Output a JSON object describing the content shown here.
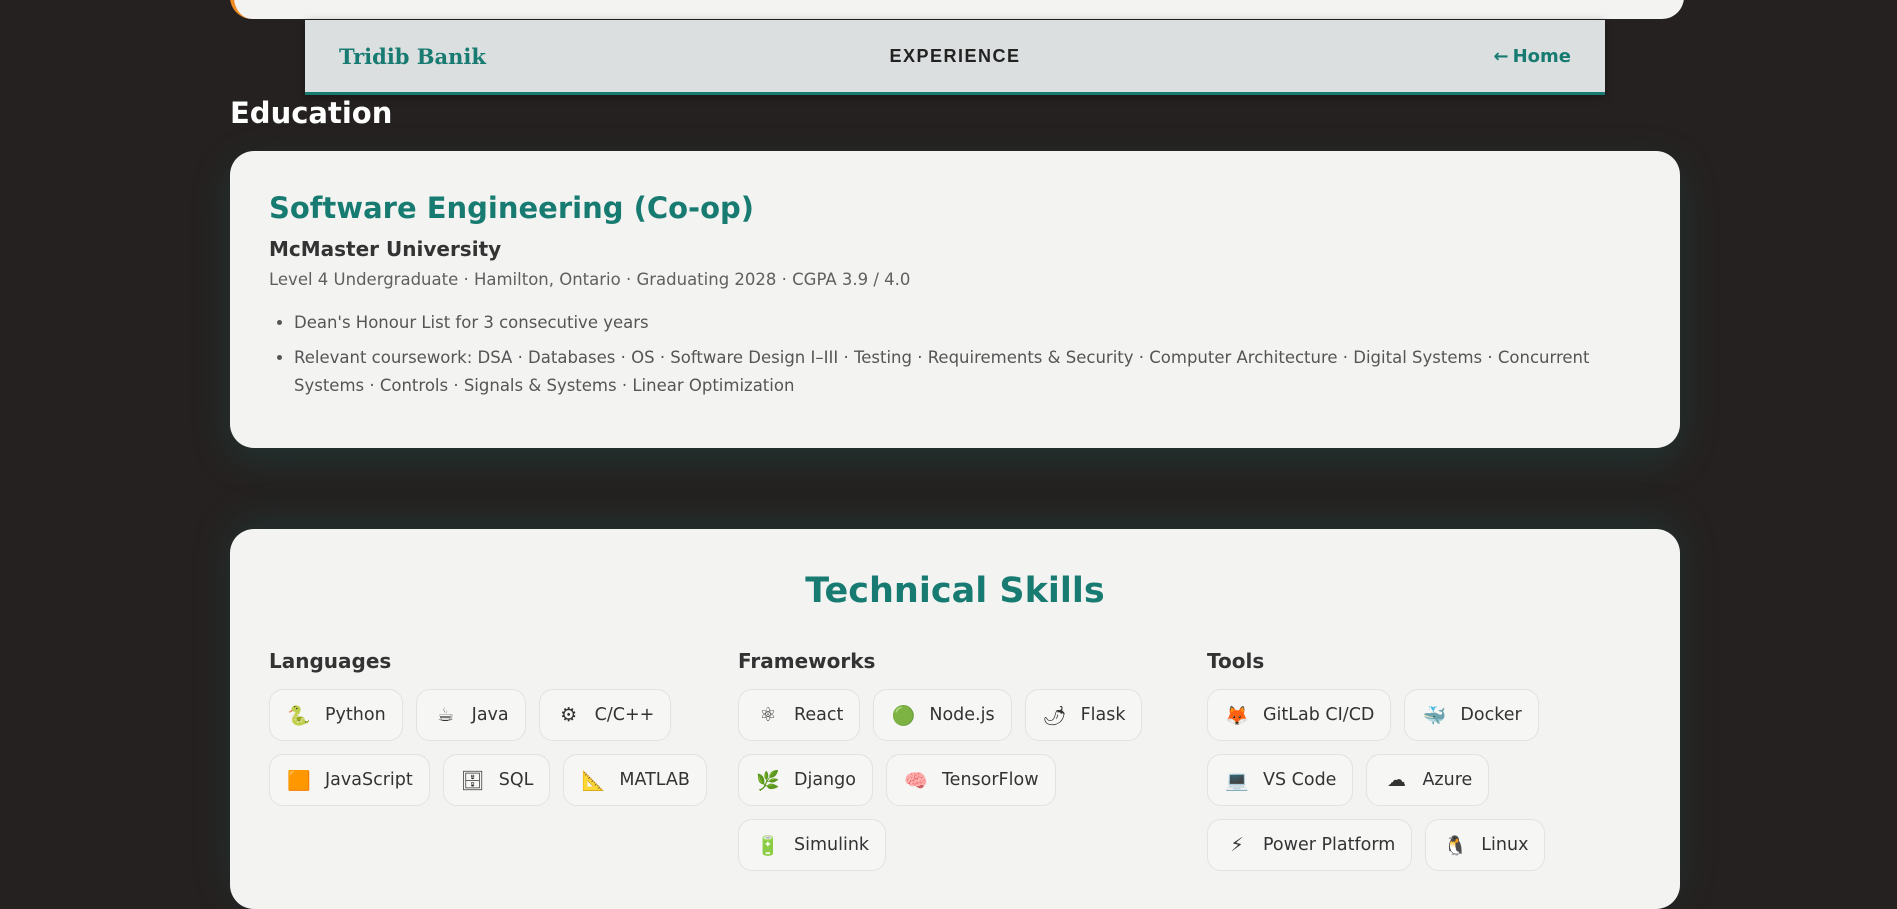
{
  "nav": {
    "brand": "Tridib Banik",
    "title": "EXPERIENCE",
    "home_arrow": "←",
    "home_label": "Home"
  },
  "education": {
    "heading": "Education",
    "degree": "Software Engineering (Co-op)",
    "school": "McMaster University",
    "meta": "Level 4 Undergraduate · Hamilton, Ontario · Graduating 2028 · CGPA 3.9 / 4.0",
    "bullets": [
      "Dean's Honour List for 3 consecutive years",
      "Relevant coursework: DSA · Databases · OS · Software Design I–III · Testing · Requirements & Security · Computer Architecture · Digital Systems · Concurrent Systems · Controls · Signals & Systems · Linear Optimization"
    ]
  },
  "skills": {
    "title": "Technical Skills",
    "languages": {
      "heading": "Languages",
      "items": [
        {
          "label": "Python",
          "icon": "snake-icon",
          "glyph": "🐍"
        },
        {
          "label": "Java",
          "icon": "coffee-icon",
          "glyph": "☕"
        },
        {
          "label": "C/C++",
          "icon": "gear-icon",
          "glyph": "⚙"
        },
        {
          "label": "JavaScript",
          "icon": "orange-square-icon",
          "glyph": "🟧"
        },
        {
          "label": "SQL",
          "icon": "file-cabinet-icon",
          "glyph": "🗄"
        },
        {
          "label": "MATLAB",
          "icon": "triangular-ruler-icon",
          "glyph": "📐"
        }
      ]
    },
    "frameworks": {
      "heading": "Frameworks",
      "items": [
        {
          "label": "React",
          "icon": "atom-icon",
          "glyph": "⚛"
        },
        {
          "label": "Node.js",
          "icon": "green-circle-icon",
          "glyph": "🟢"
        },
        {
          "label": "Flask",
          "icon": "hot-pepper-icon",
          "glyph": "🌶"
        },
        {
          "label": "Django",
          "icon": "herb-icon",
          "glyph": "🌿"
        },
        {
          "label": "TensorFlow",
          "icon": "brain-icon",
          "glyph": "🧠"
        },
        {
          "label": "Simulink",
          "icon": "battery-icon",
          "glyph": "🔋"
        }
      ]
    },
    "tools": {
      "heading": "Tools",
      "items": [
        {
          "label": "GitLab CI/CD",
          "icon": "fox-icon",
          "glyph": "🦊"
        },
        {
          "label": "Docker",
          "icon": "whale-icon",
          "glyph": "🐳"
        },
        {
          "label": "VS Code",
          "icon": "laptop-icon",
          "glyph": "💻"
        },
        {
          "label": "Azure",
          "icon": "cloud-icon",
          "glyph": "☁"
        },
        {
          "label": "Power Platform",
          "icon": "lightning-icon",
          "glyph": "⚡"
        },
        {
          "label": "Linux",
          "icon": "penguin-icon",
          "glyph": "🐧"
        }
      ]
    }
  },
  "colors": {
    "accent": "#177b72",
    "background": "#252120",
    "card": "#f3f3f2",
    "navbar": "#dcdfdf",
    "top_card_border": "#f08a24"
  }
}
